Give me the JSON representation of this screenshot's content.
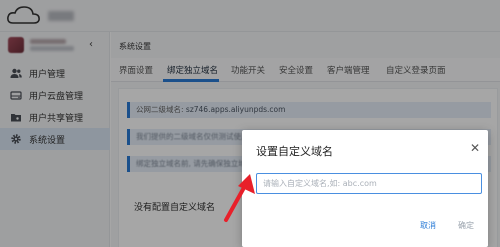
{
  "sidebar": {
    "items": [
      {
        "label": "用户管理",
        "icon": "users-icon"
      },
      {
        "label": "用户云盘管理",
        "icon": "drive-icon"
      },
      {
        "label": "用户共享管理",
        "icon": "share-folder-icon"
      },
      {
        "label": "系统设置",
        "icon": "gear-icon",
        "active": true
      }
    ]
  },
  "main": {
    "title": "系统设置",
    "tabs": [
      "界面设置",
      "绑定独立域名",
      "功能开关",
      "安全设置",
      "客户端管理",
      "自定义登录页面"
    ],
    "active_tab": "绑定独立域名",
    "info": [
      {
        "label": "公网二级域名: ",
        "value": "sz746.apps.aliyunpds.com"
      },
      {
        "text": "我们提供的二级域名仅供测试使用,..."
      },
      {
        "text": "绑定独立域名前, 请先确保独立域名..."
      }
    ],
    "no_domain": "没有配置自定义域名"
  },
  "dialog": {
    "title": "设置自定义域名",
    "input_placeholder": "请输入自定义域名,如: abc.com",
    "input_value": "",
    "cancel": "取消",
    "ok": "确定"
  },
  "colors": {
    "accent": "#2a7bd6",
    "annotation_arrow": "#e8202a"
  }
}
